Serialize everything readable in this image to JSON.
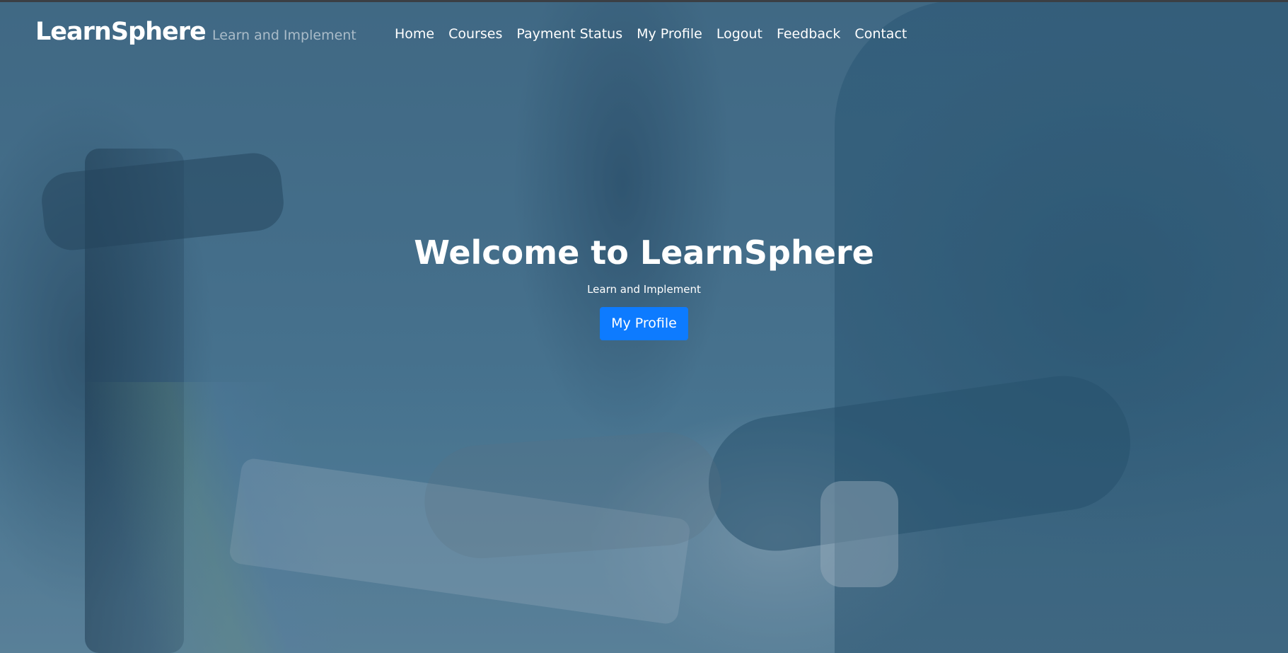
{
  "header": {
    "brand": "LearnSphere",
    "tagline": "Learn and Implement",
    "nav": [
      {
        "label": "Home"
      },
      {
        "label": "Courses"
      },
      {
        "label": "Payment Status"
      },
      {
        "label": "My Profile"
      },
      {
        "label": "Logout"
      },
      {
        "label": "Feedback"
      },
      {
        "label": "Contact"
      }
    ]
  },
  "hero": {
    "title": "Welcome to LearnSphere",
    "subtitle": "Learn and Implement",
    "button_label": "My Profile"
  },
  "colors": {
    "button": "#0d7bff",
    "overlay": "#264e6c",
    "text": "#ffffff"
  }
}
